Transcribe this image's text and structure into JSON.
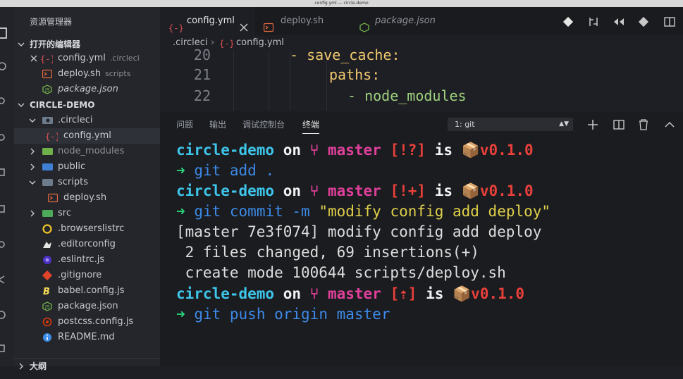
{
  "window": {
    "title": "config.yml — circle-demo"
  },
  "sidebar": {
    "title": "资源管理器",
    "open_editors": {
      "header": "打开的编辑器",
      "items": [
        {
          "name": "config.yml",
          "folder": ".circleci"
        },
        {
          "name": "deploy.sh",
          "folder": "scripts"
        },
        {
          "name": "package.json",
          "folder": ""
        }
      ]
    },
    "project": {
      "header": "CIRCLE-DEMO",
      "items": [
        {
          "name": ".circleci"
        },
        {
          "name": "config.yml"
        },
        {
          "name": "node_modules"
        },
        {
          "name": "public"
        },
        {
          "name": "scripts"
        },
        {
          "name": "deploy.sh"
        },
        {
          "name": "src"
        },
        {
          "name": ".browserslistrc"
        },
        {
          "name": ".editorconfig"
        },
        {
          "name": ".eslintrc.js"
        },
        {
          "name": ".gitignore"
        },
        {
          "name": "babel.config.js"
        },
        {
          "name": "package.json"
        },
        {
          "name": "postcss.config.js"
        },
        {
          "name": "README.md"
        }
      ]
    },
    "outline": {
      "header": "大纲"
    }
  },
  "editor": {
    "tabs": [
      {
        "label": "config.yml"
      },
      {
        "label": "deploy.sh"
      },
      {
        "label": "package.json"
      }
    ],
    "breadcrumb": {
      "folder": ".circleci",
      "file": "config.yml"
    },
    "lines": [
      {
        "num": "20",
        "text": "- save_cache:"
      },
      {
        "num": "21",
        "text": "paths:"
      },
      {
        "num": "22",
        "text": "- node_modules"
      }
    ]
  },
  "panel": {
    "tabs": [
      "问题",
      "输出",
      "调试控制台",
      "终端"
    ],
    "active_tab": "终端",
    "terminal_select": "1: git",
    "terminal": {
      "prompt_dir": "circle-demo",
      "on": "on",
      "branch": "master",
      "is": "is",
      "version": "v0.1.0",
      "status1": "[!?]",
      "status2": "[!+]",
      "status3": "[⇡]",
      "cmd1": "git add .",
      "cmd2_a": "git commit -m ",
      "cmd2_b": "\"modify config add deploy\"",
      "out1": "[master 7e3f074] modify config add deploy",
      "out2": " 2 files changed, 69 insertions(+)",
      "out3": " create mode 100644 scripts/deploy.sh",
      "cmd3": "git push origin master"
    }
  },
  "colors": {
    "cyan": "#3ec5ea",
    "pink": "#e0409a",
    "red": "#e8403a",
    "green": "#29d67a",
    "yellow_string": "#e0d04a"
  }
}
